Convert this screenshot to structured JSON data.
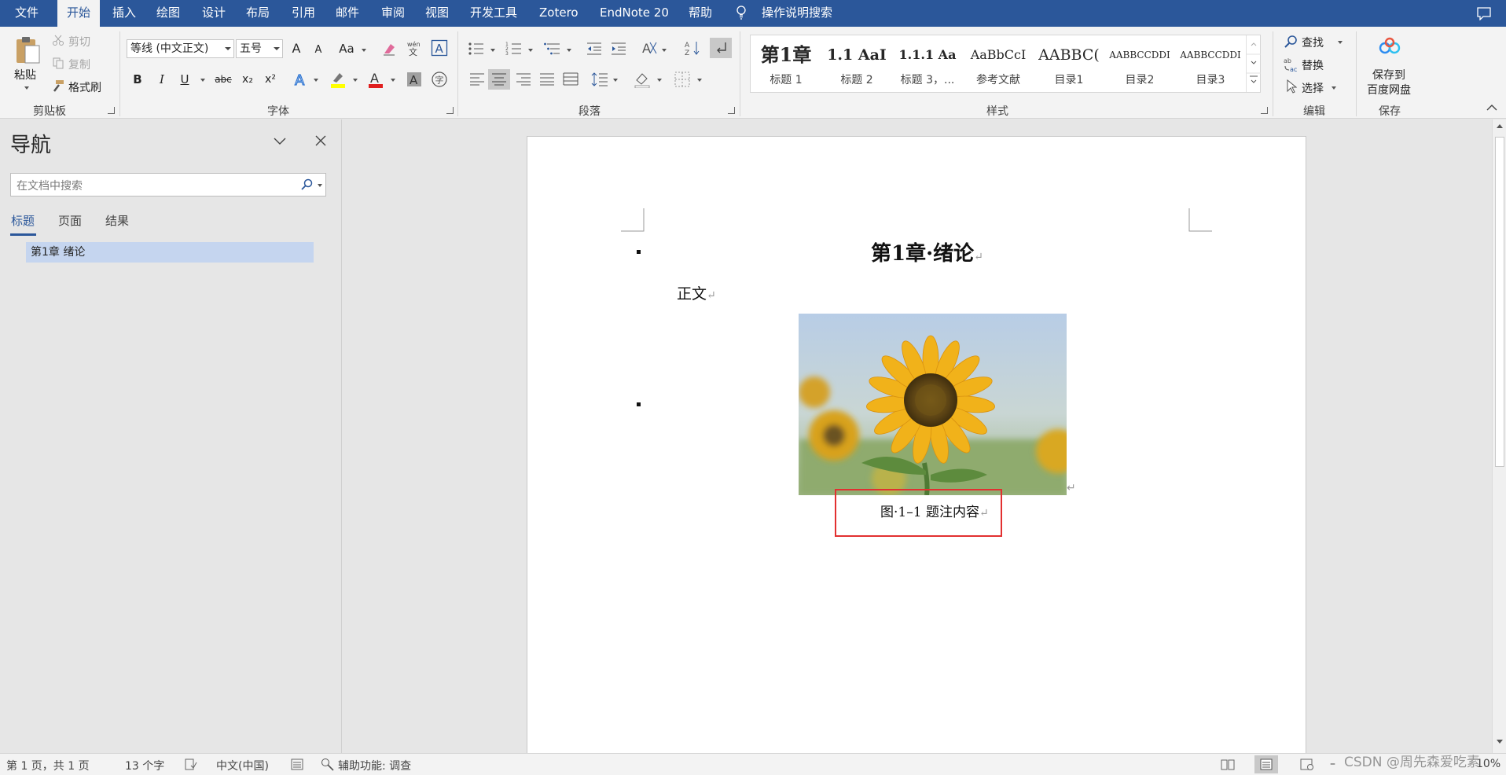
{
  "menubar": {
    "file": "文件",
    "home": "开始",
    "insert": "插入",
    "draw": "绘图",
    "design": "设计",
    "layout": "布局",
    "references": "引用",
    "mailings": "邮件",
    "review": "审阅",
    "view": "视图",
    "developer": "开发工具",
    "zotero": "Zotero",
    "endnote": "EndNote 20",
    "help": "帮助",
    "tell_me": "操作说明搜索"
  },
  "clipboard": {
    "paste": "粘贴",
    "cut": "剪切",
    "copy": "复制",
    "format_painter": "格式刷",
    "group_label": "剪贴板"
  },
  "font": {
    "name": "等线 (中文正文)",
    "size": "五号",
    "grow": "A",
    "shrink": "A",
    "change_case": "Aa",
    "bold": "B",
    "italic": "I",
    "underline": "U",
    "strike": "abc",
    "subscript": "x₂",
    "superscript": "x²",
    "group_label": "字体"
  },
  "paragraph": {
    "group_label": "段落"
  },
  "styles": {
    "group_label": "样式",
    "items": [
      {
        "sample": "第1章",
        "name": "标题 1"
      },
      {
        "sample": "1.1  AaI",
        "name": "标题 2"
      },
      {
        "sample": "1.1.1  Aa",
        "name": "标题 3，..."
      },
      {
        "sample": "AaBbCcI",
        "name": "参考文献"
      },
      {
        "sample": "AABBC(",
        "name": "目录1"
      },
      {
        "sample": "AABBCCDDI",
        "name": "目录2"
      },
      {
        "sample": "AABBCCDDI",
        "name": "目录3"
      }
    ]
  },
  "editing": {
    "find": "查找",
    "replace": "替换",
    "select": "选择",
    "group_label": "编辑"
  },
  "save": {
    "label_line1": "保存到",
    "label_line2": "百度网盘",
    "group_label": "保存"
  },
  "nav": {
    "title": "导航",
    "search_placeholder": "在文档中搜索",
    "tabs": [
      "标题",
      "页面",
      "结果"
    ],
    "items": [
      "第1章 绪论"
    ]
  },
  "document": {
    "heading": "第1章·绪论",
    "body": "正文",
    "caption": "图·1–1 题注内容",
    "para_mark": "↵"
  },
  "status": {
    "page": "第 1 页，共 1 页",
    "words": "13 个字",
    "language": "中文(中国)",
    "accessibility": "辅助功能: 调查",
    "zoom": "10%"
  },
  "watermark": "CSDN @周先森爱吃素"
}
